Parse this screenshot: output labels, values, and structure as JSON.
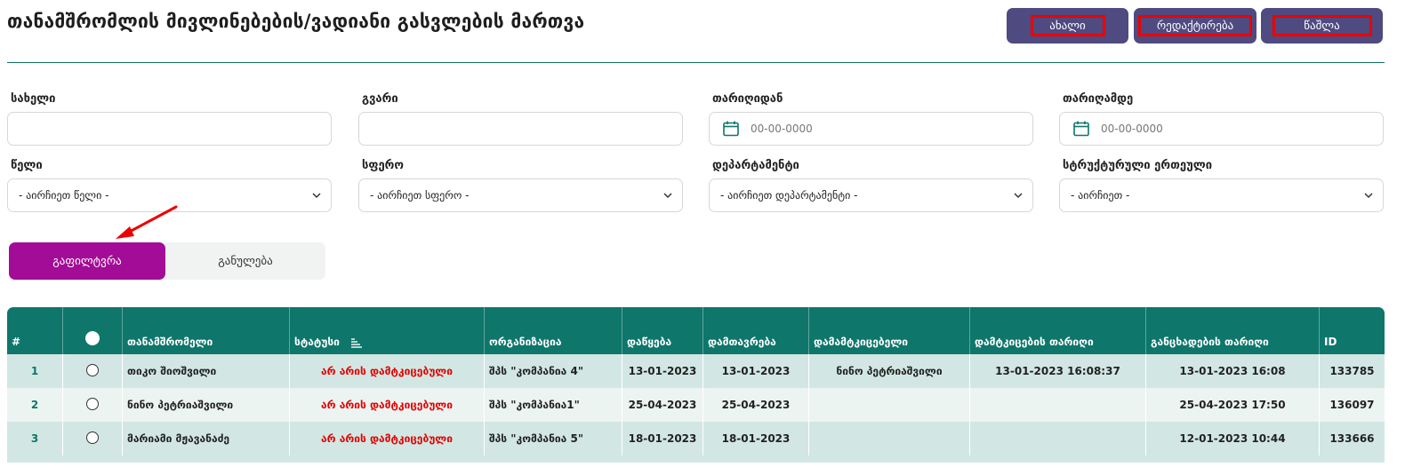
{
  "header": {
    "title": "თანამშრომლის მივლინებების/ვადიანი გასვლების მართვა",
    "buttons": {
      "new": "ახალი",
      "edit": "რედაქტირება",
      "delete": "წაშლა"
    }
  },
  "filters": {
    "name": {
      "label": "სახელი",
      "value": ""
    },
    "surname": {
      "label": "გვარი",
      "value": ""
    },
    "date_from": {
      "label": "თარიღიდან",
      "placeholder": "00-00-0000"
    },
    "date_to": {
      "label": "თარიღამდე",
      "placeholder": "00-00-0000"
    },
    "year": {
      "label": "წელი",
      "selected": "- აირჩიეთ წელი -"
    },
    "sphere": {
      "label": "სფერო",
      "selected": "- აირჩიეთ სფერო -"
    },
    "department": {
      "label": "დეპარტამენტი",
      "selected": "- აირჩიეთ დეპარტამენტი -"
    },
    "unit": {
      "label": "სტრუქტურული ერთეული",
      "selected": "- აირჩიეთ -"
    },
    "filter_button": "გაფილტვრა",
    "reset_button": "განულება"
  },
  "table": {
    "columns": [
      "#",
      "",
      "თანამშრომელი",
      "სტატუსი",
      "ორგანიზაცია",
      "დაწყება",
      "დამთავრება",
      "დამამტკიცებელი",
      "დამტკიცების თარიღი",
      "განცხადების თარიღი",
      "ID"
    ],
    "rows": [
      {
        "num": "1",
        "employee": "თიკო შიოშვილი",
        "status": "არ არის დამტკიცებული",
        "org": "შპს \"კომპანია 4\"",
        "start": "13-01-2023",
        "end": "13-01-2023",
        "approver": "ნინო პეტრიაშვილი",
        "approved_at": "13-01-2023 16:08:37",
        "applied_at": "13-01-2023 16:08",
        "id": "133785"
      },
      {
        "num": "2",
        "employee": "ნინო პეტრიაშვილი",
        "status": "არ არის დამტკიცებული",
        "org": "შპს \"კომპანია1\"",
        "start": "25-04-2023",
        "end": "25-04-2023",
        "approver": "",
        "approved_at": "",
        "applied_at": "25-04-2023 17:50",
        "id": "136097"
      },
      {
        "num": "3",
        "employee": "მარიამი მჟავანაძე",
        "status": "არ არის დამტკიცებული",
        "org": "შპს \"კომპანია 5\"",
        "start": "18-01-2023",
        "end": "18-01-2023",
        "approver": "",
        "approved_at": "",
        "applied_at": "12-01-2023 10:44",
        "id": "133666"
      }
    ]
  },
  "colors": {
    "teal": "#0e766b",
    "purple_button": "#4f4a80",
    "filter_button": "#a30c96",
    "status_red": "#e20000",
    "annotation_red": "#ee0000"
  },
  "icons": [
    "calendar-icon",
    "chevron-down-icon",
    "sort-icon",
    "radio-icon",
    "annotation-arrow-icon"
  ]
}
